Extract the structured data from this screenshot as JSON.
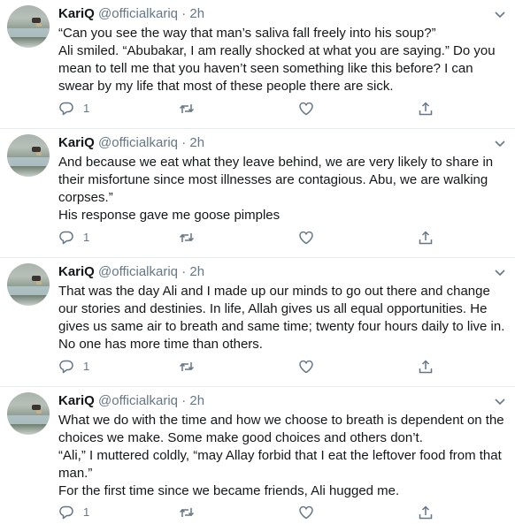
{
  "tweets": [
    {
      "name": "KariQ",
      "handle": "@officialkariq",
      "separator": "·",
      "time": "2h",
      "lines": [
        "“Can you see the way that man’s saliva fall freely into his soup?”",
        "Ali smiled. “Abubakar, I am really shocked at what you are saying.” Do you mean to tell me that you haven’t seen something like this before? I can swear by my life that most of these people there are sick."
      ],
      "replies": "1"
    },
    {
      "name": "KariQ",
      "handle": "@officialkariq",
      "separator": "·",
      "time": "2h",
      "lines": [
        "And because we eat what they leave behind, we are very likely to share in their misfortune since most illnesses are contagious. Abu, we are walking corpses.”",
        "His response gave me goose pimples"
      ],
      "replies": "1"
    },
    {
      "name": "KariQ",
      "handle": "@officialkariq",
      "separator": "·",
      "time": "2h",
      "lines": [
        "That was the day Ali and I made up our minds to go out there and change our stories and destinies. In life, Allah gives us all equal opportunities. He gives us same air to breath and same time; twenty four hours daily to live in. No one has more time than others."
      ],
      "replies": "1"
    },
    {
      "name": "KariQ",
      "handle": "@officialkariq",
      "separator": "·",
      "time": "2h",
      "lines": [
        "What we do with the time and how we choose to breath is dependent on the choices we make. Some make good choices and others don’t.",
        "“Ali,” I muttered coldly, “may Allay forbid that I eat the leftover food from that man.”",
        "For the first time since we became friends, Ali hugged me."
      ],
      "replies": "1"
    }
  ],
  "icons": {
    "reply": "reply-icon",
    "retweet": "retweet-icon",
    "like": "like-icon",
    "share": "share-icon",
    "caret": "chevron-down-icon"
  },
  "colors": {
    "text": "#14171a",
    "secondary": "#657786",
    "divider": "#e6ecf0"
  }
}
